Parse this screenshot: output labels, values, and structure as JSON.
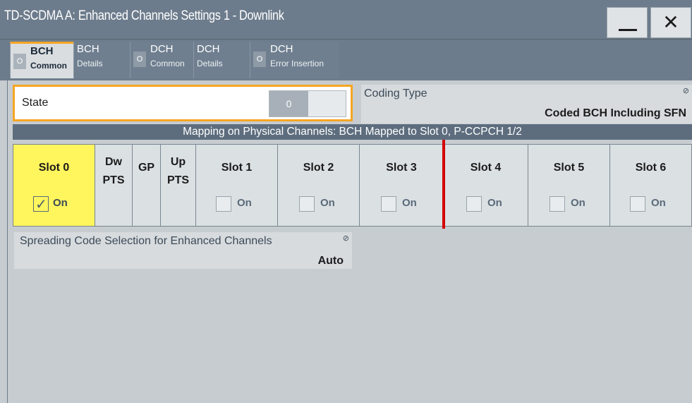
{
  "window": {
    "title": "TD-SCDMA A: Enhanced Channels Settings 1 - Downlink",
    "minimize_icon": "minimize-icon",
    "close_label": "✕"
  },
  "tabs": [
    {
      "line1": "BCH",
      "line2": "Common",
      "radio": "O",
      "active": true
    },
    {
      "line1": "BCH",
      "line2": "Details",
      "radio": "",
      "active": false
    },
    {
      "line1": "DCH",
      "line2": "Common",
      "radio": "O",
      "active": false
    },
    {
      "line1": "DCH",
      "line2": "Details",
      "radio": "",
      "active": false
    },
    {
      "line1": "DCH",
      "line2": "Error Insertion",
      "radio": "O",
      "active": false
    }
  ],
  "state": {
    "label": "State",
    "toggle_value": "0"
  },
  "coding_type": {
    "label": "Coding Type",
    "value": "Coded BCH Including SFN"
  },
  "mapping": {
    "text": "Mapping on Physical Channels: BCH Mapped to Slot 0, P-CCPCH 1/2"
  },
  "slots": [
    {
      "title": "Slot 0",
      "on_label": "On",
      "checked": true
    },
    {
      "title": "Slot 1",
      "on_label": "On",
      "checked": false
    },
    {
      "title": "Slot 2",
      "on_label": "On",
      "checked": false
    },
    {
      "title": "Slot 3",
      "on_label": "On",
      "checked": false
    },
    {
      "title": "Slot 4",
      "on_label": "On",
      "checked": false
    },
    {
      "title": "Slot 5",
      "on_label": "On",
      "checked": false
    },
    {
      "title": "Slot 6",
      "on_label": "On",
      "checked": false
    }
  ],
  "pilots": {
    "dwpts": {
      "line1": "Dw",
      "line2": "PTS"
    },
    "gp": {
      "line1": "GP"
    },
    "uppts": {
      "line1": "Up",
      "line2": "PTS"
    }
  },
  "spreading": {
    "label": "Spreading Code Selection for Enhanced Channels",
    "value": "Auto"
  },
  "colors": {
    "accent": "#f5a623",
    "selected_slot": "#fff55c",
    "marker": "#d40000"
  }
}
